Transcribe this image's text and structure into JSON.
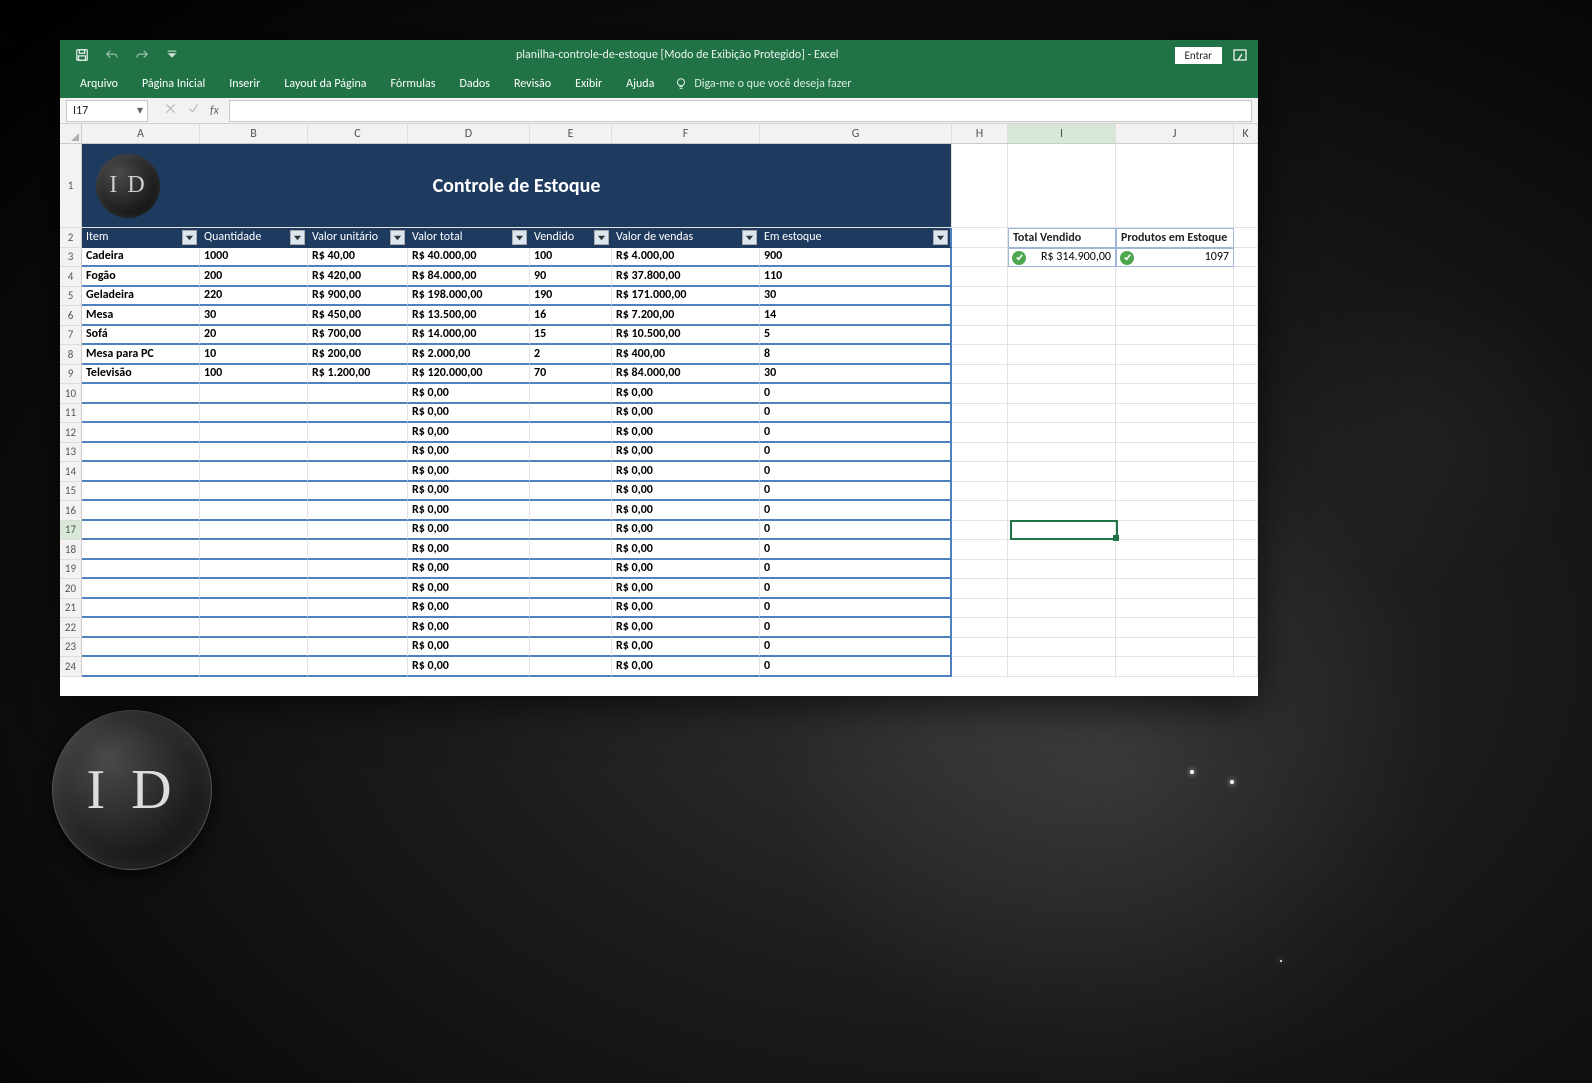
{
  "window": {
    "title": "planilha-controle-de-estoque  [Modo de Exibição Protegido]  -  Excel",
    "signin": "Entrar"
  },
  "ribbon": {
    "tabs": [
      "Arquivo",
      "Página Inicial",
      "Inserir",
      "Layout da Página",
      "Fórmulas",
      "Dados",
      "Revisão",
      "Exibir",
      "Ajuda"
    ],
    "tellme": "Diga-me o que você deseja fazer"
  },
  "formula_bar": {
    "name_box": "I17",
    "formula": ""
  },
  "columns": [
    "A",
    "B",
    "C",
    "D",
    "E",
    "F",
    "G",
    "H",
    "I",
    "J",
    "K"
  ],
  "row_labels_start": 1,
  "row_labels_end": 24,
  "banner": {
    "logo_text": "I D",
    "title": "Controle de Estoque"
  },
  "table": {
    "headers": [
      "Item",
      "Quantidade",
      "Valor unitário",
      "Valor total",
      "Vendido",
      "Valor  de vendas",
      "Em estoque"
    ],
    "rows": [
      [
        "Cadeira",
        "1000",
        "R$ 40,00",
        "R$ 40.000,00",
        "100",
        "R$ 4.000,00",
        "900"
      ],
      [
        "Fogão",
        "200",
        "R$ 420,00",
        "R$ 84.000,00",
        "90",
        "R$ 37.800,00",
        "110"
      ],
      [
        "Geladeira",
        "220",
        "R$ 900,00",
        "R$ 198.000,00",
        "190",
        "R$ 171.000,00",
        "30"
      ],
      [
        "Mesa",
        "30",
        "R$ 450,00",
        "R$ 13.500,00",
        "16",
        "R$ 7.200,00",
        "14"
      ],
      [
        "Sofá",
        "20",
        "R$ 700,00",
        "R$ 14.000,00",
        "15",
        "R$ 10.500,00",
        "5"
      ],
      [
        "Mesa para PC",
        "10",
        "R$ 200,00",
        "R$ 2.000,00",
        "2",
        "R$ 400,00",
        "8"
      ],
      [
        "Televisão",
        "100",
        "R$ 1.200,00",
        "R$ 120.000,00",
        "70",
        "R$ 84.000,00",
        "30"
      ],
      [
        "",
        "",
        "",
        "R$ 0,00",
        "",
        "R$ 0,00",
        "0"
      ],
      [
        "",
        "",
        "",
        "R$ 0,00",
        "",
        "R$ 0,00",
        "0"
      ],
      [
        "",
        "",
        "",
        "R$ 0,00",
        "",
        "R$ 0,00",
        "0"
      ],
      [
        "",
        "",
        "",
        "R$ 0,00",
        "",
        "R$ 0,00",
        "0"
      ],
      [
        "",
        "",
        "",
        "R$ 0,00",
        "",
        "R$ 0,00",
        "0"
      ],
      [
        "",
        "",
        "",
        "R$ 0,00",
        "",
        "R$ 0,00",
        "0"
      ],
      [
        "",
        "",
        "",
        "R$ 0,00",
        "",
        "R$ 0,00",
        "0"
      ],
      [
        "",
        "",
        "",
        "R$ 0,00",
        "",
        "R$ 0,00",
        "0"
      ],
      [
        "",
        "",
        "",
        "R$ 0,00",
        "",
        "R$ 0,00",
        "0"
      ],
      [
        "",
        "",
        "",
        "R$ 0,00",
        "",
        "R$ 0,00",
        "0"
      ],
      [
        "",
        "",
        "",
        "R$ 0,00",
        "",
        "R$ 0,00",
        "0"
      ],
      [
        "",
        "",
        "",
        "R$ 0,00",
        "",
        "R$ 0,00",
        "0"
      ],
      [
        "",
        "",
        "",
        "R$ 0,00",
        "",
        "R$ 0,00",
        "0"
      ],
      [
        "",
        "",
        "",
        "R$ 0,00",
        "",
        "R$ 0,00",
        "0"
      ],
      [
        "",
        "",
        "",
        "R$ 0,00",
        "",
        "R$ 0,00",
        "0"
      ]
    ]
  },
  "summary": {
    "total_vendido_label": "Total Vendido",
    "total_vendido_value": "R$ 314.900,00",
    "produtos_estoque_label": "Produtos em Estoque",
    "produtos_estoque_value": "1097"
  },
  "active_cell": "I17",
  "watermark": "I D"
}
